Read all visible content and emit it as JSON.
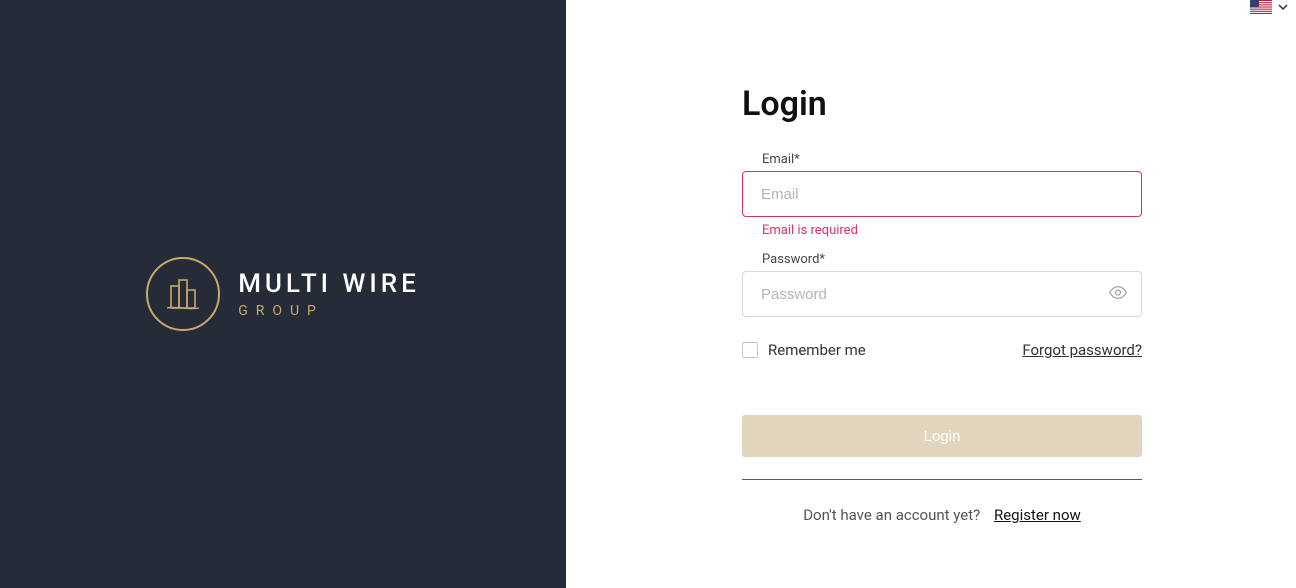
{
  "brand": {
    "line1": "MULTI WIRE",
    "line2": "GROUP"
  },
  "lang": {
    "selected_icon_name": "flag-usa"
  },
  "login": {
    "title": "Login",
    "email_label": "Email*",
    "email_placeholder": "Email",
    "email_value": "",
    "email_error": "Email is required",
    "password_label": "Password*",
    "password_placeholder": "Password",
    "password_value": "",
    "remember_label": "Remember me",
    "forgot_label": "Forgot password?",
    "submit_label": "Login",
    "register_prompt": "Don't have an account yet?",
    "register_link": "Register now"
  },
  "colors": {
    "dark_bg": "#262b38",
    "gold": "#c7a96a",
    "error": "#d6336c",
    "button_bg": "#e1d6bd"
  }
}
